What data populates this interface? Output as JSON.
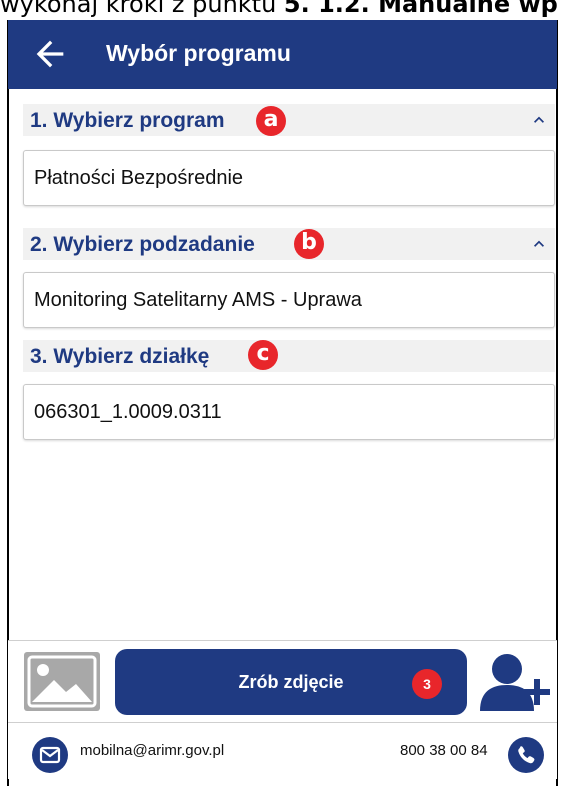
{
  "caption": {
    "prefix": "wykonaj kroki z punktu ",
    "bold": "5. 1.2. Manualne wp"
  },
  "appbar": {
    "title": "Wybór programu"
  },
  "sections": [
    {
      "label": "1. Wybierz program",
      "badge": "a",
      "value": "Płatności Bezpośrednie"
    },
    {
      "label": "2. Wybierz podzadanie",
      "badge": "b",
      "value": "Monitoring Satelitarny AMS - Uprawa"
    },
    {
      "label": "3. Wybierz działkę",
      "badge": "c",
      "value": "066301_1.0009.0311"
    }
  ],
  "bottom": {
    "photo_button": "Zrób zdjęcie",
    "count_badge": "3"
  },
  "footer": {
    "email": "mobilna@arimr.gov.pl",
    "phone": "800 38 00 84"
  },
  "colors": {
    "primary": "#1f3a82",
    "badge": "#e8262b",
    "header_bg": "#f1f1f1"
  },
  "icons": {
    "back": "arrow-left-icon",
    "collapse": "chevron-up-icon",
    "gallery": "image-icon",
    "add_user": "user-add-icon",
    "mail": "mail-icon",
    "phone": "phone-icon"
  }
}
